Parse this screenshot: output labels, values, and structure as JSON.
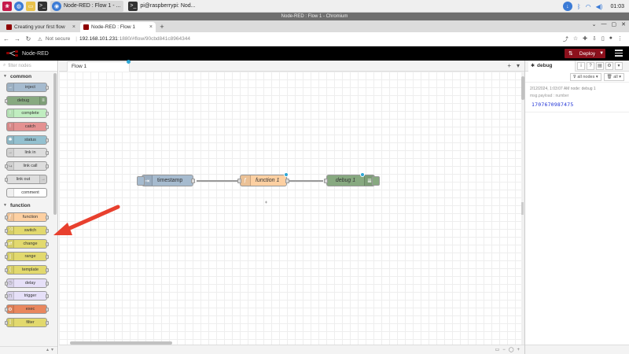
{
  "taskbar": {
    "apps": [
      {
        "label": "Node-RED : Flow 1 - ...",
        "active": true
      },
      {
        "label": "pi@raspberrypi: Nod...",
        "active": false
      }
    ],
    "clock": "01:03"
  },
  "browser": {
    "window_title": "Node-RED : Flow 1 - Chromium",
    "tabs": [
      {
        "label": "Creating your first flow"
      },
      {
        "label": "Node-RED : Flow 1"
      }
    ],
    "new_tab": "+",
    "address": {
      "security": "Not secure",
      "host": "192.168.101.231",
      "path": ":1880/#flow/90cbd841c8964344"
    }
  },
  "nodered": {
    "title": "Node-RED",
    "deploy_label": "Deploy"
  },
  "palette": {
    "filter_placeholder": "filter nodes",
    "categories": [
      {
        "name": "common",
        "nodes": [
          {
            "label": "inject",
            "color": "#a6bbcf"
          },
          {
            "label": "debug",
            "color": "#87a980"
          },
          {
            "label": "complete",
            "color": "#c0edc0"
          },
          {
            "label": "catch",
            "color": "#e49191"
          },
          {
            "label": "status",
            "color": "#94c1d0"
          },
          {
            "label": "link in",
            "color": "#dddddd"
          },
          {
            "label": "link call",
            "color": "#dddddd"
          },
          {
            "label": "link out",
            "color": "#dddddd"
          },
          {
            "label": "comment",
            "color": "#ffffff"
          }
        ]
      },
      {
        "name": "function",
        "nodes": [
          {
            "label": "function",
            "color": "#fdd0a2"
          },
          {
            "label": "switch",
            "color": "#e2d96e"
          },
          {
            "label": "change",
            "color": "#e2d96e"
          },
          {
            "label": "range",
            "color": "#e2d96e"
          },
          {
            "label": "template",
            "color": "#e2d96e"
          },
          {
            "label": "delay",
            "color": "#e6e0f8"
          },
          {
            "label": "trigger",
            "color": "#e6e0f8"
          },
          {
            "label": "exec",
            "color": "#e9875e"
          },
          {
            "label": "filter",
            "color": "#e2d96e"
          }
        ]
      }
    ]
  },
  "workspace": {
    "flow_tab": "Flow 1",
    "nodes": [
      {
        "label": "timestamp",
        "color": "#a6bbcf",
        "type": "inject"
      },
      {
        "label": "function 1",
        "color": "#fdd0a2",
        "type": "function"
      },
      {
        "label": "debug 1",
        "color": "#87a980",
        "type": "debug"
      }
    ]
  },
  "sidebar": {
    "tab_label": "debug",
    "filter_label": "all nodes",
    "clear_label": "all",
    "message": {
      "meta": "2/12/2024, 1:03:07 AM  node: debug 1",
      "topic": "msg.payload : number",
      "value": "1707670987475"
    }
  },
  "colors": {
    "accent": "#8c101c",
    "header": "#000000",
    "changed_dot": "#2da7d6",
    "arrow": "#e8402e"
  }
}
